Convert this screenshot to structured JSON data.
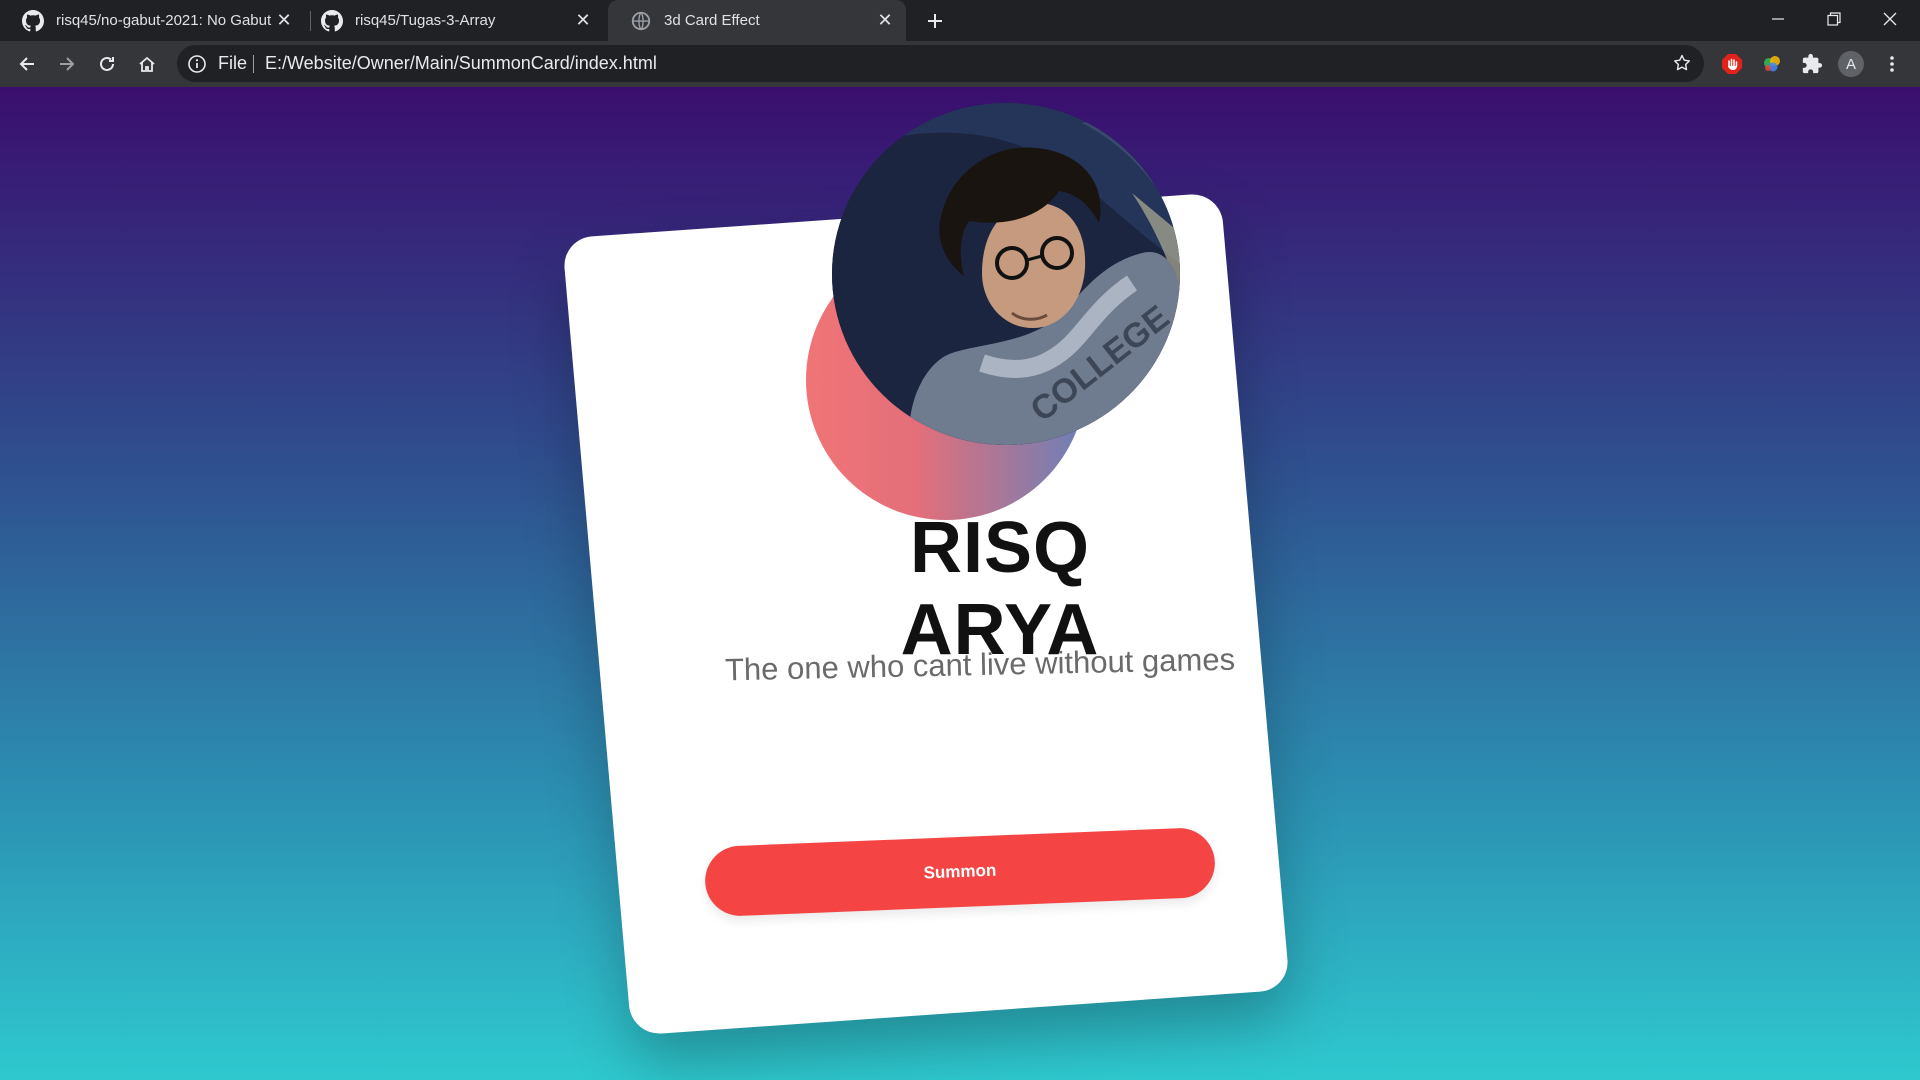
{
  "browser": {
    "tabs": [
      {
        "title": "risq45/no-gabut-2021: No Gabut",
        "favicon": "github-icon"
      },
      {
        "title": "risq45/Tugas-3-Array",
        "favicon": "github-icon"
      },
      {
        "title": "3d Card Effect",
        "favicon": "globe-icon",
        "active": true
      }
    ],
    "address": {
      "scheme_label": "File",
      "url": "E:/Website/Owner/Main/SummonCard/index.html"
    },
    "profile_initial": "A"
  },
  "page": {
    "name": "RISQ ARYA",
    "tagline": "The one who cant live without games",
    "button_label": "Summon",
    "colors": {
      "button": "#f44444",
      "circle_start": "#f07476",
      "circle_end": "#6a80b9",
      "bg_top": "#3a0e6e",
      "bg_bottom": "#2ec9cf"
    }
  }
}
